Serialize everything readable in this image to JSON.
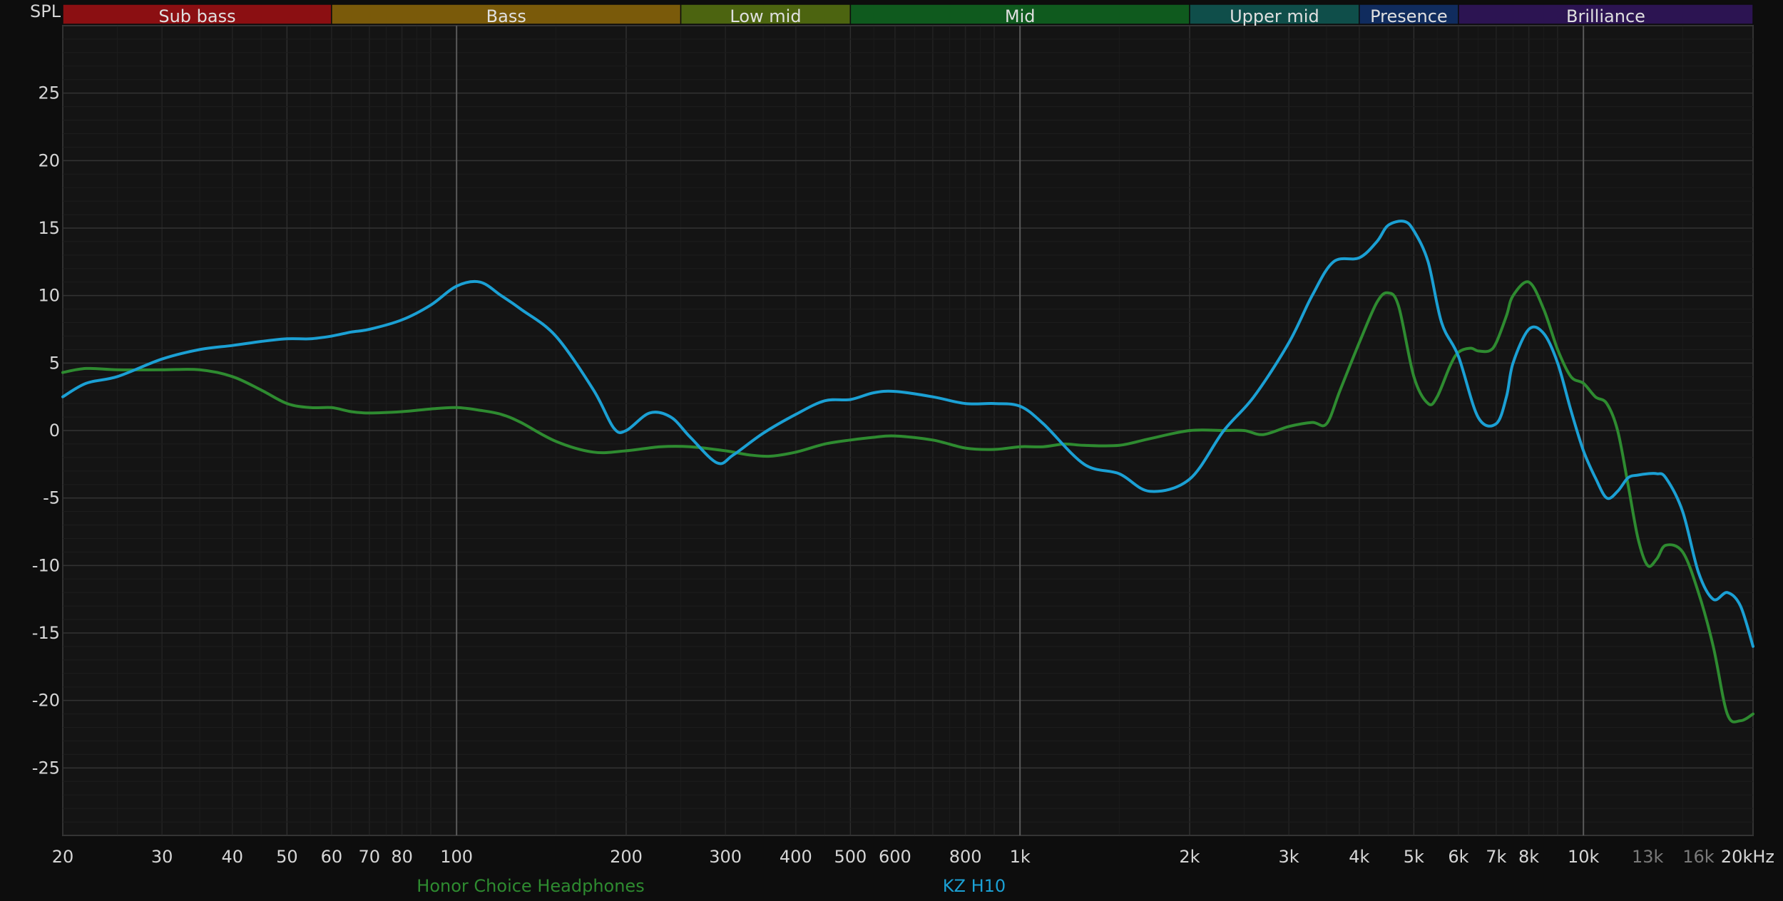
{
  "chart_data": {
    "type": "line",
    "title": "",
    "ylabel": "SPL",
    "xunit": "kHz",
    "xscale": "log",
    "xlim": [
      20,
      20000
    ],
    "ylim": [
      -30,
      30
    ],
    "grid": true,
    "legend_position": "bottom-center",
    "bands": [
      {
        "label": "Sub bass",
        "from": 20,
        "to": 60,
        "color": "#8b0f12"
      },
      {
        "label": "Bass",
        "from": 60,
        "to": 250,
        "color": "#7a5a0a"
      },
      {
        "label": "Low mid",
        "from": 250,
        "to": 500,
        "color": "#4c6410"
      },
      {
        "label": "Mid",
        "from": 500,
        "to": 2000,
        "color": "#0f5a1e"
      },
      {
        "label": "Upper mid",
        "from": 2000,
        "to": 4000,
        "color": "#0f4e4a"
      },
      {
        "label": "Presence",
        "from": 4000,
        "to": 6000,
        "color": "#102c5e"
      },
      {
        "label": "Brilliance",
        "from": 6000,
        "to": 20000,
        "color": "#2c1452"
      }
    ],
    "x_ticks": [
      {
        "value": 20,
        "label": "20",
        "dim": false
      },
      {
        "value": 30,
        "label": "30",
        "dim": false
      },
      {
        "value": 40,
        "label": "40",
        "dim": false
      },
      {
        "value": 50,
        "label": "50",
        "dim": false
      },
      {
        "value": 60,
        "label": "60",
        "dim": false
      },
      {
        "value": 70,
        "label": "70",
        "dim": false
      },
      {
        "value": 80,
        "label": "80",
        "dim": false
      },
      {
        "value": 100,
        "label": "100",
        "dim": false
      },
      {
        "value": 200,
        "label": "200",
        "dim": false
      },
      {
        "value": 300,
        "label": "300",
        "dim": false
      },
      {
        "value": 400,
        "label": "400",
        "dim": false
      },
      {
        "value": 500,
        "label": "500",
        "dim": false
      },
      {
        "value": 600,
        "label": "600",
        "dim": false
      },
      {
        "value": 800,
        "label": "800",
        "dim": false
      },
      {
        "value": 1000,
        "label": "1k",
        "dim": false
      },
      {
        "value": 2000,
        "label": "2k",
        "dim": false
      },
      {
        "value": 3000,
        "label": "3k",
        "dim": false
      },
      {
        "value": 4000,
        "label": "4k",
        "dim": false
      },
      {
        "value": 5000,
        "label": "5k",
        "dim": false
      },
      {
        "value": 6000,
        "label": "6k",
        "dim": false
      },
      {
        "value": 7000,
        "label": "7k",
        "dim": false
      },
      {
        "value": 8000,
        "label": "8k",
        "dim": false
      },
      {
        "value": 10000,
        "label": "10k",
        "dim": false
      },
      {
        "value": 13000,
        "label": "13k",
        "dim": true
      },
      {
        "value": 16000,
        "label": "16k",
        "dim": true
      },
      {
        "value": 20000,
        "label": "20kHz",
        "dim": false
      }
    ],
    "y_ticks": [
      25,
      20,
      15,
      10,
      5,
      0,
      -5,
      -10,
      -15,
      -20,
      -25
    ],
    "series": [
      {
        "name": "Honor Choice Headphones",
        "color": "#2e8b30",
        "x": [
          20,
          22,
          25,
          30,
          35,
          40,
          45,
          50,
          55,
          60,
          65,
          70,
          80,
          90,
          100,
          110,
          120,
          130,
          150,
          175,
          200,
          230,
          260,
          300,
          330,
          360,
          400,
          450,
          500,
          550,
          600,
          700,
          800,
          900,
          1000,
          1100,
          1200,
          1300,
          1500,
          1700,
          2000,
          2300,
          2500,
          2700,
          3000,
          3300,
          3500,
          3700,
          4000,
          4300,
          4500,
          4700,
          5000,
          5300,
          5500,
          5800,
          6000,
          6300,
          6500,
          6800,
          7000,
          7300,
          7500,
          8000,
          8500,
          9000,
          9500,
          10000,
          10500,
          11000,
          11500,
          12000,
          12500,
          13000,
          13500,
          14000,
          15000,
          16000,
          17000,
          18000,
          19000,
          20000
        ],
        "y": [
          4.3,
          4.6,
          4.5,
          4.5,
          4.5,
          4.0,
          3.0,
          2.0,
          1.7,
          1.7,
          1.4,
          1.3,
          1.4,
          1.6,
          1.7,
          1.5,
          1.2,
          0.6,
          -0.8,
          -1.6,
          -1.5,
          -1.2,
          -1.2,
          -1.5,
          -1.8,
          -1.9,
          -1.6,
          -1.0,
          -0.7,
          -0.5,
          -0.4,
          -0.7,
          -1.3,
          -1.4,
          -1.2,
          -1.2,
          -1.0,
          -1.1,
          -1.1,
          -0.6,
          0.0,
          0.0,
          0.0,
          -0.3,
          0.3,
          0.6,
          0.5,
          3.0,
          6.5,
          9.5,
          10.2,
          9.2,
          4.0,
          2.0,
          2.5,
          4.8,
          5.8,
          6.1,
          5.9,
          5.9,
          6.5,
          8.5,
          10.0,
          11.0,
          9.0,
          6.0,
          4.0,
          3.5,
          2.5,
          2.0,
          0.0,
          -4.0,
          -8.0,
          -10.0,
          -9.5,
          -8.5,
          -9.0,
          -12.0,
          -16.0,
          -21.0,
          -21.5,
          -21.0
        ]
      },
      {
        "name": "KZ H10",
        "color": "#1ba0d4",
        "x": [
          20,
          22,
          25,
          30,
          35,
          40,
          45,
          50,
          55,
          60,
          65,
          70,
          80,
          90,
          100,
          110,
          120,
          130,
          150,
          175,
          190,
          200,
          220,
          240,
          260,
          290,
          310,
          350,
          400,
          450,
          500,
          550,
          600,
          700,
          800,
          900,
          1000,
          1100,
          1300,
          1500,
          1700,
          2000,
          2300,
          2600,
          3000,
          3300,
          3600,
          4000,
          4300,
          4500,
          4800,
          5000,
          5300,
          5600,
          6000,
          6500,
          7000,
          7300,
          7500,
          8000,
          8500,
          9000,
          9500,
          10000,
          10500,
          11000,
          11500,
          12000,
          12500,
          13000,
          13500,
          14000,
          15000,
          16000,
          17000,
          18000,
          19000,
          20000
        ],
        "y": [
          2.5,
          3.5,
          4.0,
          5.3,
          6.0,
          6.3,
          6.6,
          6.8,
          6.8,
          7.0,
          7.3,
          7.5,
          8.2,
          9.3,
          10.7,
          11.0,
          10.0,
          9.0,
          7.0,
          3.0,
          0.2,
          0.0,
          1.3,
          1.0,
          -0.5,
          -2.4,
          -1.8,
          -0.2,
          1.2,
          2.2,
          2.3,
          2.8,
          2.9,
          2.5,
          2.0,
          2.0,
          1.8,
          0.5,
          -2.5,
          -3.2,
          -4.5,
          -3.6,
          0.0,
          2.5,
          6.5,
          10.0,
          12.5,
          12.8,
          14.0,
          15.2,
          15.5,
          14.8,
          12.5,
          8.0,
          5.5,
          1.0,
          0.5,
          2.5,
          5.0,
          7.5,
          7.2,
          5.0,
          1.5,
          -1.5,
          -3.5,
          -5.0,
          -4.5,
          -3.5,
          -3.3,
          -3.2,
          -3.2,
          -3.5,
          -6.0,
          -10.5,
          -12.5,
          -12.0,
          -13.0,
          -16.0
        ]
      }
    ]
  }
}
